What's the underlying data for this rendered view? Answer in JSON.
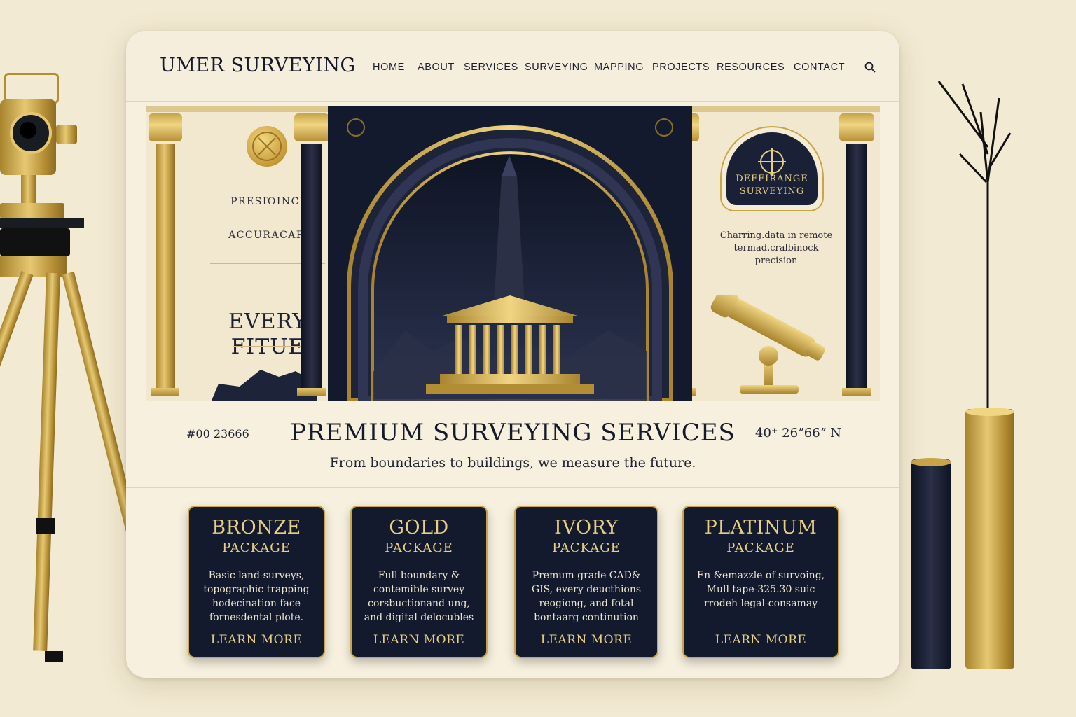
{
  "site": {
    "logo": "UMER SURVEYING"
  },
  "nav": {
    "items": [
      {
        "label": "HOME"
      },
      {
        "label": "ABOUT"
      },
      {
        "label": "SERVICES"
      },
      {
        "label": "SURVEYING"
      },
      {
        "label": "MAPPING"
      },
      {
        "label": "PROJECTS"
      },
      {
        "label": "RESOURCES"
      },
      {
        "label": "CONTACT"
      }
    ],
    "search_icon": "search-icon"
  },
  "hero": {
    "left": {
      "line1": "PRESIOINCI",
      "line2": "ACCURACAF.",
      "line3": "EVERY",
      "line4": "FITUE"
    },
    "badge": {
      "line1": "DEFFIRANGE",
      "line2": "SURVEYING"
    },
    "badge_caption": {
      "line1": "Charring.data in remote",
      "line2": "termad.cralbinock",
      "line3": "precision"
    }
  },
  "headline": {
    "code_left": "#00 23666",
    "title": "PREMIUM SURVEYING SERVICES",
    "coords": "40⁺ 26ˮ66ˮ N",
    "tagline": "From boundaries to buildings, we measure the future."
  },
  "packages": [
    {
      "title": "BRONZE",
      "subtitle": "PACKAGE",
      "lines": [
        "Basic land-surveys,",
        "topographic trapping",
        "hodecination face",
        "fornesdental plote."
      ],
      "cta": "LEARN MORE"
    },
    {
      "title": "GOLD",
      "subtitle": "PACKAGE",
      "lines": [
        "Full boundary &",
        "contemible survey",
        "corsbuctionand ung,",
        "and digital delocubles"
      ],
      "cta": "LEARN MORE"
    },
    {
      "title": "IVORY",
      "subtitle": "PACKAGE",
      "lines": [
        "Premum grade CAD&",
        "GIS, every deucthions",
        "reogiong, and fotal",
        "bontaarg continution"
      ],
      "cta": "LEARN MORE"
    },
    {
      "title": "PLATINUM",
      "subtitle": "PACKAGE",
      "lines": [
        "En &emazzle of survoing,",
        "Mull tape-325.30 suic",
        "rrodeh legal-consamay"
      ],
      "cta": "LEARN MORE"
    }
  ],
  "colors": {
    "gold": "#c9a448",
    "navy": "#141a2d",
    "cream": "#f7f0de",
    "background": "#f3ead3"
  }
}
